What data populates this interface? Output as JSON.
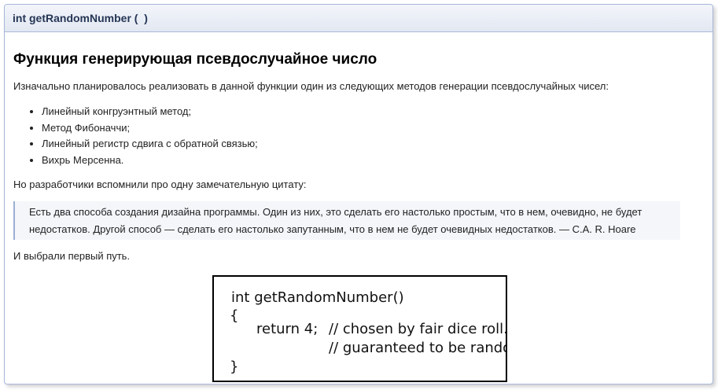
{
  "member": {
    "signature": "int getRandomNumber (  )"
  },
  "doc": {
    "heading": "Функция генерирующая псевдослучайное число",
    "intro": "Изначально планировалось реализовать в данной функции один из следующих методов генерации псевдослучайных чисел:",
    "methods": [
      "Линейный конгруэнтный метод;",
      "Метод Фибоначчи;",
      "Линейный регистр сдвига с обратной связью;",
      "Вихрь Мерсенна."
    ],
    "quote_lead": "Но разработчики вспомнили про одну замечательную цитату:",
    "quote": "Есть два способа создания дизайна программы. Один из них, это сделать его настолько простым, что в нем, очевидно, не будет недостатков. Другой способ — сделать его настолько запутанным, что в нем не будет очевидных недостатков. — C.A. R. Hoare",
    "closing": "И выбрали первый путь."
  },
  "comic": {
    "line1": "int getRandomNumber()",
    "line2": "{",
    "line3_code": "return 4;",
    "line3_comment": "// chosen by fair dice roll.",
    "line4_comment": "// guaranteed to be random.",
    "line5": "}"
  }
}
